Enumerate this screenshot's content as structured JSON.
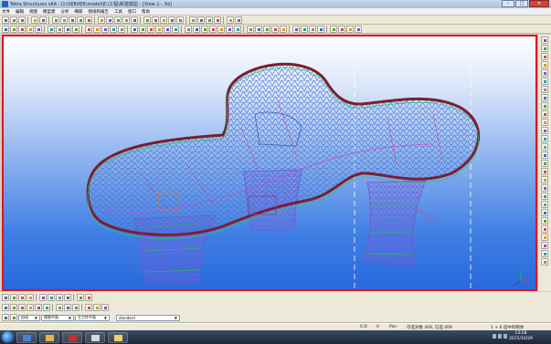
{
  "window": {
    "title": "Tekla Structures x64 - D:\\SERVER\\model\\E:\\工程\\新建模型 - [View 1 - 3d]",
    "buttons": {
      "minimize": "–",
      "maximize": "□",
      "close": "✕"
    }
  },
  "menu": {
    "items": [
      "文件",
      "编辑",
      "视图",
      "模型建",
      "分析",
      "细部",
      "图纸和报告",
      "工具",
      "窗口",
      "帮助"
    ]
  },
  "icons": {
    "toolbar1": [
      "new-icon",
      "open-icon",
      "save-icon",
      "undo-icon",
      "redo-icon",
      "select-icon",
      "copy-icon",
      "move-icon",
      "delete-icon",
      "properties-icon",
      "zoom-icon",
      "pan-icon",
      "rotate-icon",
      "snap-icon",
      "grid-icon",
      "column-icon",
      "beam-icon",
      "plate-icon",
      "bolt-icon",
      "weld-icon",
      "component-icon",
      "drawing-icon",
      "report-icon",
      "numbering-icon",
      "clash-icon",
      "help-icon"
    ],
    "toolbar2": [
      "steel-column-icon",
      "steel-beam-icon",
      "polybeam-icon",
      "curved-beam-icon",
      "twin-profile-icon",
      "contour-plate-icon",
      "bent-plate-icon",
      "pad-footing-icon",
      "strip-footing-icon",
      "concrete-column-icon",
      "concrete-beam-icon",
      "slab-icon",
      "panel-icon",
      "rebar-icon",
      "mesh-icon",
      "surface-icon",
      "cut-icon",
      "fitting-icon",
      "chamfer-icon",
      "split-icon",
      "combine-icon",
      "assembly-icon",
      "cast-unit-icon",
      "point-icon",
      "line-icon",
      "arc-icon",
      "circle-icon",
      "dimension-icon",
      "text-icon",
      "cloud-icon",
      "measure-icon",
      "inquire-icon",
      "view-icon",
      "clip-icon",
      "work-area-icon",
      "layer-icon",
      "filter-icon",
      "phase-icon",
      "lot-icon",
      "organizer-icon"
    ],
    "right": [
      "snap-end-icon",
      "snap-mid-icon",
      "snap-center-icon",
      "snap-intersect-icon",
      "snap-perp-icon",
      "snap-line-icon",
      "snap-any-icon",
      "snap-ref-icon",
      "snap-geometry-icon",
      "snap-nearest-icon",
      "snap-free-icon",
      "orto-icon",
      "plane-icon",
      "arrow-left-icon",
      "arrow-right-icon",
      "arrow-up-icon",
      "arrow-down-icon",
      "tag-icon",
      "dim-icon",
      "mark-icon",
      "lock-icon",
      "hide-icon",
      "show-icon",
      "color-icon",
      "render-icon",
      "section-icon",
      "camera-icon",
      "light-icon"
    ],
    "bottom1": [
      "select-all-icon",
      "select-part-icon",
      "select-circle-icon",
      "select-surface-icon",
      "select-grid-icon",
      "select-point-icon",
      "select-bolt-icon",
      "select-weld-icon",
      "select-component-icon",
      "select-assembly-icon"
    ],
    "bottom2": [
      "snap-ref-icon",
      "snap-geom-icon",
      "snap-point-icon",
      "snap-end-icon",
      "snap-center-icon",
      "snap-mid-icon",
      "snap-intersect-icon",
      "snap-perp-icon",
      "snap-ext-icon",
      "snap-free-icon",
      "snap-nearest-icon",
      "snap-line-icon"
    ],
    "bottom3": [
      "grid-select-icon",
      "move-icon"
    ]
  },
  "controls": {
    "auto_label": "自动",
    "view_plane": "视图平面",
    "work_plane": "主工作平面",
    "standard": "standard"
  },
  "status": {
    "snap": "S D",
    "count": "0",
    "mode": "Pan",
    "selection": "可选对象 409, 已选 409",
    "selected_summary": "1 + 0 选中的物体"
  },
  "taskbar": {
    "time": "13:28",
    "date": "2015/10/29"
  },
  "colors": {
    "viewport_border": "#e0151e",
    "frame_edge": "#7a1f2e",
    "bg_top": "#ffffff",
    "bg_bottom": "#2969dc"
  }
}
